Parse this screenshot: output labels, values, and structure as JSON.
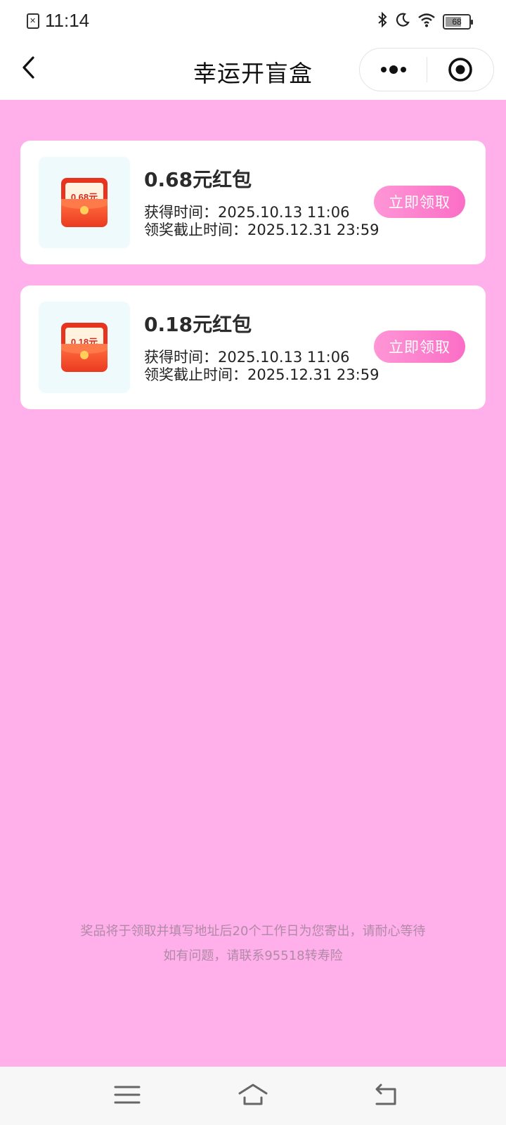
{
  "status_bar": {
    "time": "11:14",
    "battery_level": "68",
    "battery_fraction": 0.68,
    "icons": [
      "sim-error-icon",
      "bluetooth-icon",
      "moon-icon",
      "wifi-icon",
      "battery-icon"
    ]
  },
  "nav": {
    "title": "幸运开盲盒",
    "icons": [
      "back-icon",
      "more-icon",
      "close-mini-program-icon"
    ]
  },
  "prizes": [
    {
      "envelope_amount": "0.68元",
      "title": "0.68元红包",
      "obtained": "获得时间：2025.10.13 11:06",
      "deadline": "领奖截止时间：2025.12.31 23:59",
      "button": "立即领取"
    },
    {
      "envelope_amount": "0.18元",
      "title": "0.18元红包",
      "obtained": "获得时间：2025.10.13 11:06",
      "deadline": "领奖截止时间：2025.12.31 23:59",
      "button": "立即领取"
    }
  ],
  "notice": {
    "line1": "奖品将于领取并填写地址后20个工作日为您寄出，请耐心等待",
    "line2": "如有问题，请联系95518转寿险"
  },
  "colors": {
    "page_background": "#ffafe9",
    "button": "#fb6ec6",
    "envelope": "#e8341f"
  },
  "system_nav": {
    "icons": [
      "menu-icon",
      "home-icon",
      "back-nav-icon"
    ]
  }
}
